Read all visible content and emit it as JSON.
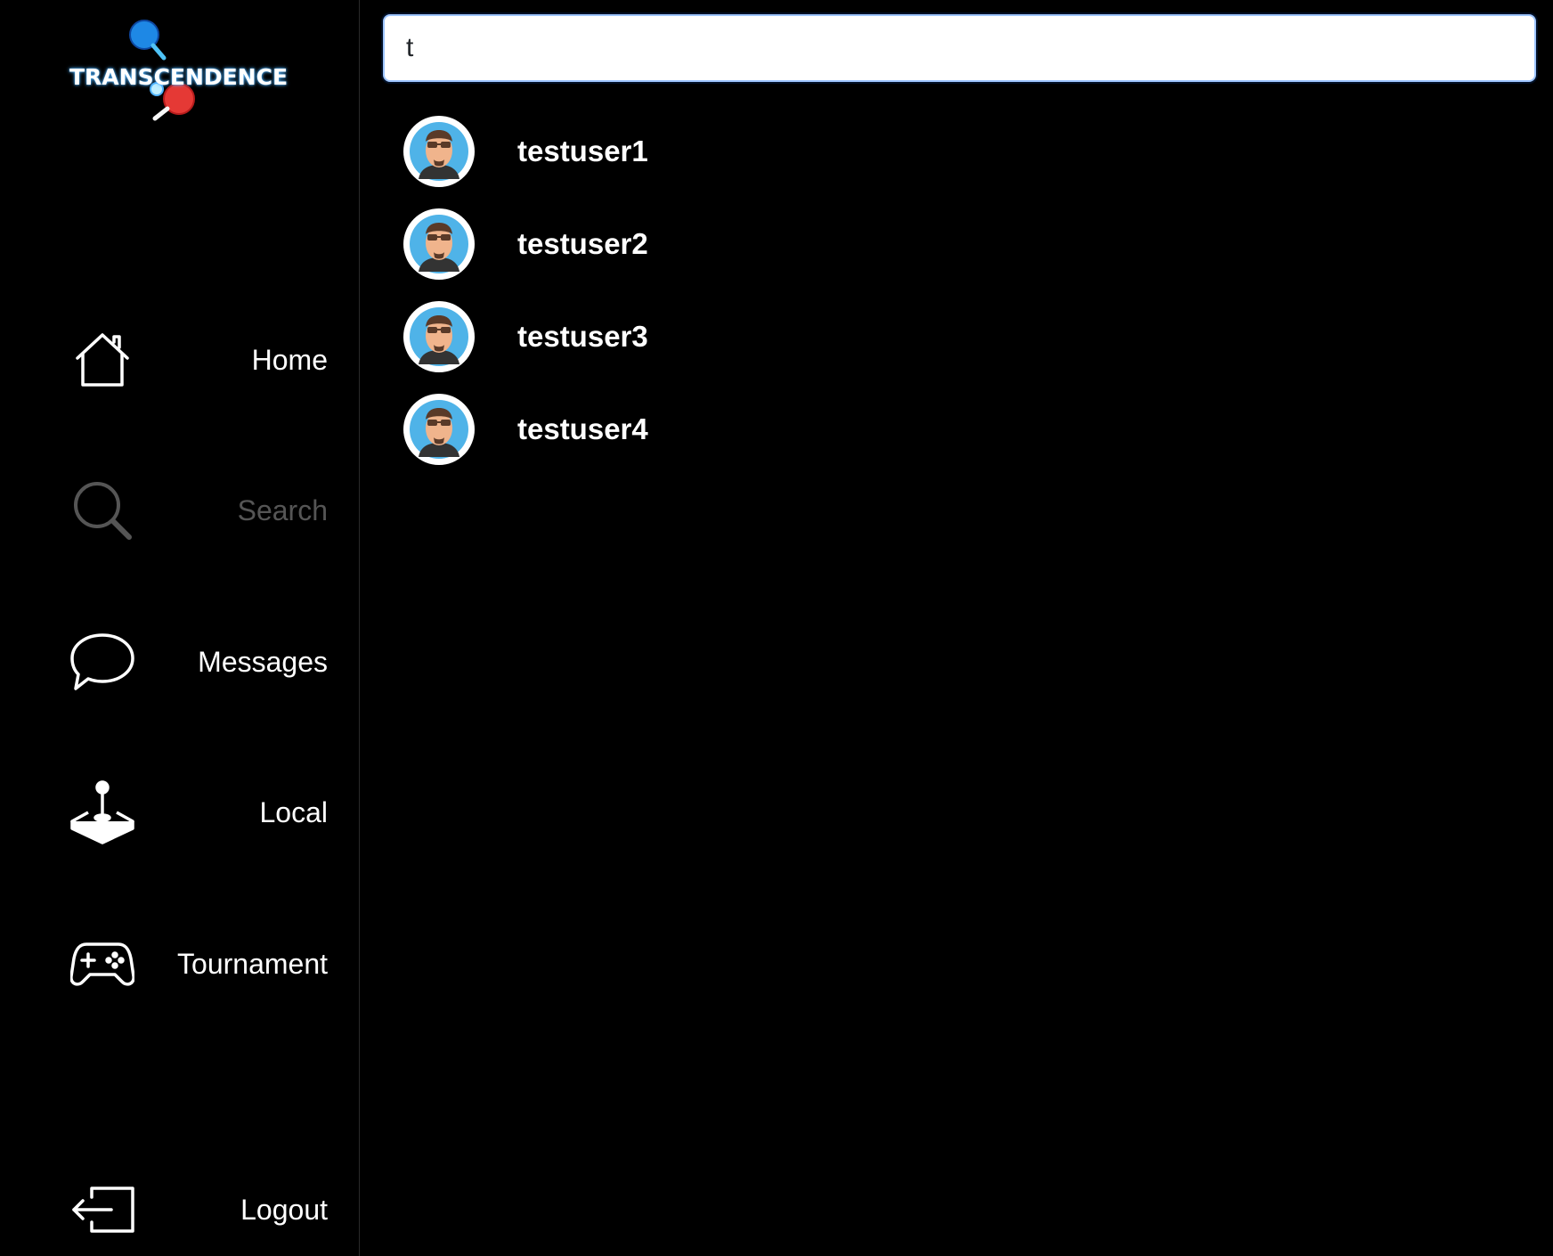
{
  "app": {
    "brand": "TRANSCENDENCE"
  },
  "colors": {
    "background": "#000000",
    "text": "#ffffff",
    "muted": "#555555",
    "paddle_blue": "#1e88e5",
    "paddle_red": "#e53935",
    "avatar_bg": "#4fb3e8"
  },
  "sidebar": {
    "items": [
      {
        "label": "Home",
        "icon": "home-icon",
        "active": false
      },
      {
        "label": "Search",
        "icon": "search-icon",
        "active": true
      },
      {
        "label": "Messages",
        "icon": "message-icon",
        "active": false
      },
      {
        "label": "Local",
        "icon": "joystick-icon",
        "active": false
      },
      {
        "label": "Tournament",
        "icon": "gamepad-icon",
        "active": false
      }
    ],
    "logout": {
      "label": "Logout",
      "icon": "logout-icon"
    }
  },
  "search": {
    "value": "t"
  },
  "results": [
    {
      "username": "testuser1",
      "avatar": "avatar-icon"
    },
    {
      "username": "testuser2",
      "avatar": "avatar-icon"
    },
    {
      "username": "testuser3",
      "avatar": "avatar-icon"
    },
    {
      "username": "testuser4",
      "avatar": "avatar-icon"
    }
  ]
}
